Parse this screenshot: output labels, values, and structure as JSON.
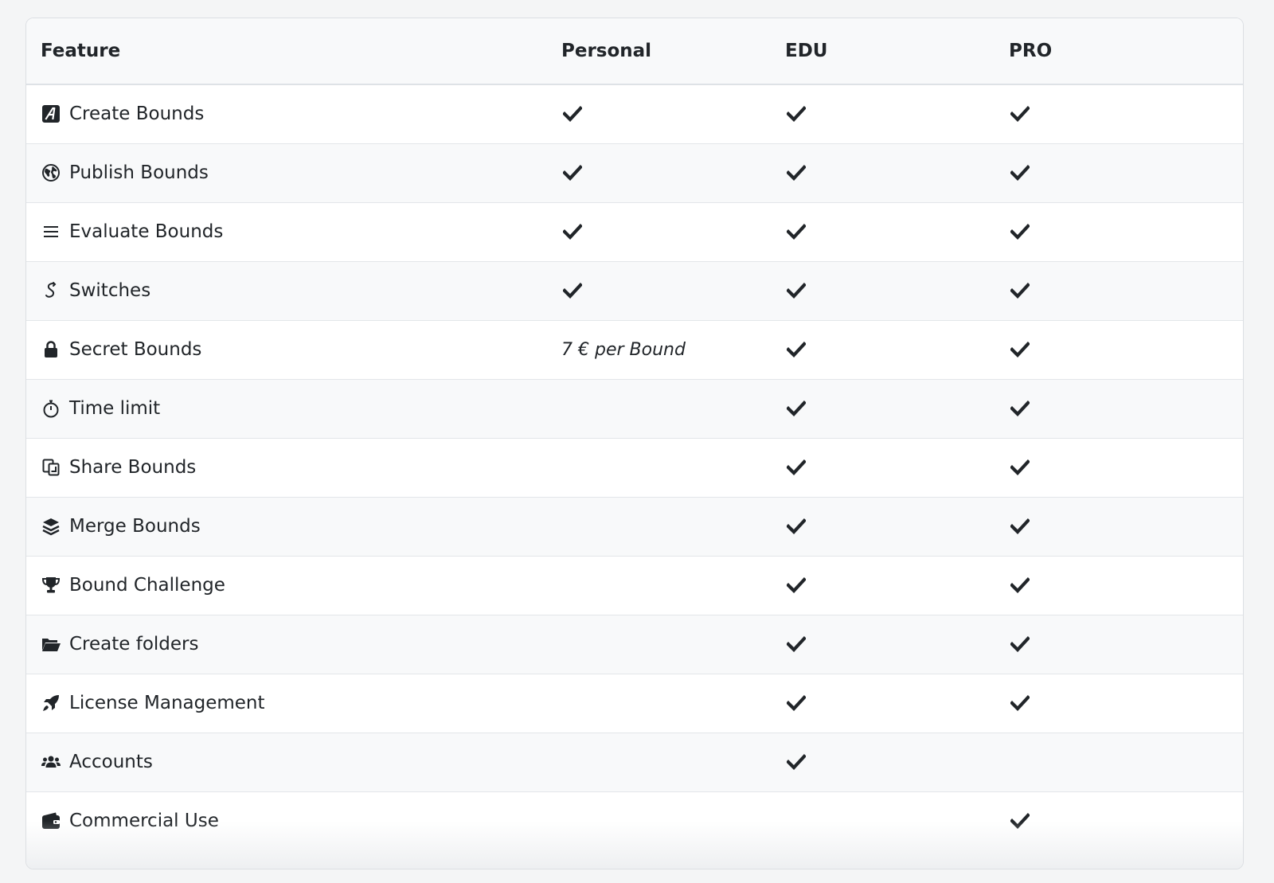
{
  "table": {
    "headers": [
      "Feature",
      "Personal",
      "EDU",
      "PRO"
    ],
    "rows": [
      {
        "feature": "Create Bounds",
        "icon": "create-bounds-icon",
        "personal": "check",
        "edu": "check",
        "pro": "check"
      },
      {
        "feature": "Publish Bounds",
        "icon": "globe-icon",
        "personal": "check",
        "edu": "check",
        "pro": "check"
      },
      {
        "feature": "Evaluate Bounds",
        "icon": "list-icon",
        "personal": "check",
        "edu": "check",
        "pro": "check"
      },
      {
        "feature": "Switches",
        "icon": "switch-icon",
        "personal": "check",
        "edu": "check",
        "pro": "check"
      },
      {
        "feature": "Secret Bounds",
        "icon": "lock-icon",
        "personal": "7 € per Bound",
        "edu": "check",
        "pro": "check"
      },
      {
        "feature": "Time limit",
        "icon": "stopwatch-icon",
        "personal": "",
        "edu": "check",
        "pro": "check"
      },
      {
        "feature": "Share Bounds",
        "icon": "copy-icon",
        "personal": "",
        "edu": "check",
        "pro": "check"
      },
      {
        "feature": "Merge Bounds",
        "icon": "layers-icon",
        "personal": "",
        "edu": "check",
        "pro": "check"
      },
      {
        "feature": "Bound Challenge",
        "icon": "trophy-icon",
        "personal": "",
        "edu": "check",
        "pro": "check"
      },
      {
        "feature": "Create folders",
        "icon": "folder-icon",
        "personal": "",
        "edu": "check",
        "pro": "check"
      },
      {
        "feature": "License Management",
        "icon": "rocket-icon",
        "personal": "",
        "edu": "check",
        "pro": "check"
      },
      {
        "feature": "Accounts",
        "icon": "users-icon",
        "personal": "",
        "edu": "check",
        "pro": ""
      },
      {
        "feature": "Commercial Use",
        "icon": "wallet-icon",
        "personal": "",
        "edu": "",
        "pro": "check"
      }
    ]
  }
}
